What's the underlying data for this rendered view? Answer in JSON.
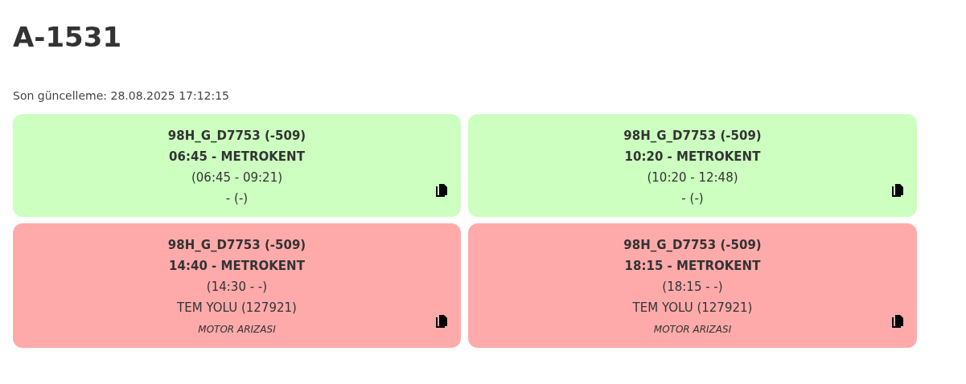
{
  "title": "A-1531",
  "last_update": "Son güncelleme: 28.08.2025 17:12:15",
  "trips": [
    {
      "color": "#ccffc0",
      "vehicle": "98H_G_D7753 (-509)",
      "departure": "06:45 - METROKENT",
      "times": "(06:45 - 09:21)",
      "location": "- (-)"
    },
    {
      "color": "#ccffc0",
      "vehicle": "98H_G_D7753 (-509)",
      "departure": "10:20 - METROKENT",
      "times": "(10:20 - 12:48)",
      "location": "- (-)"
    },
    {
      "color": "#ffaaaa",
      "vehicle": "98H_G_D7753 (-509)",
      "departure": "14:40 - METROKENT",
      "times": "(14:30 - -)",
      "location": "TEM YOLU (127921)",
      "note": "MOTOR ARIZASI"
    },
    {
      "color": "#ffaaaa",
      "vehicle": "98H_G_D7753 (-509)",
      "departure": "18:15 - METROKENT",
      "times": "(18:15 - -)",
      "location": "TEM YOLU (127921)",
      "note": "MOTOR ARIZASI"
    }
  ]
}
